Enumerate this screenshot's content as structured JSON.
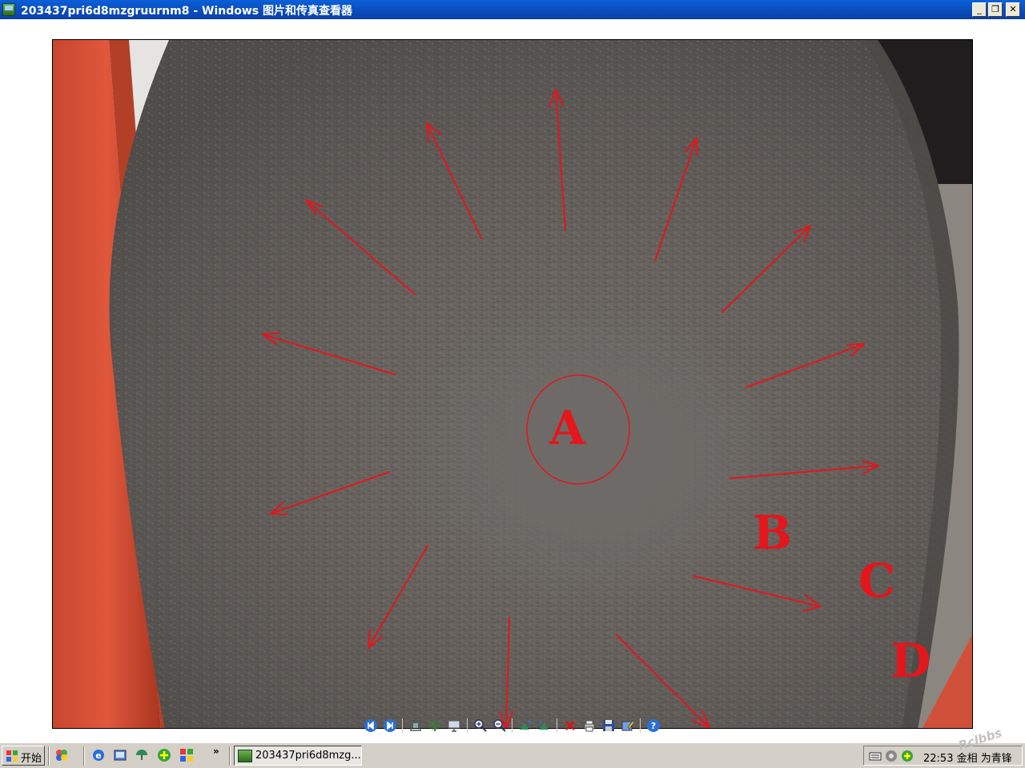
{
  "window": {
    "title": "203437pri6d8mzgruurnm8 - Windows 图片和传真查看器",
    "min": "_",
    "max": "❐",
    "close": "✕"
  },
  "photo": {
    "labels": {
      "a": "A",
      "b": "B",
      "c": "C",
      "d": "D"
    }
  },
  "toolbar": {
    "icons": [
      "prev-image-icon",
      "next-image-icon",
      "best-fit-icon",
      "actual-size-icon",
      "slideshow-icon",
      "zoom-in-icon",
      "zoom-out-icon",
      "rotate-clockwise-icon",
      "rotate-counterclockwise-icon",
      "delete-icon",
      "print-icon",
      "save-icon",
      "edit-icon",
      "help-icon"
    ]
  },
  "taskbar": {
    "start_label": "开始",
    "overflow": "»",
    "task_label": "203437pri6d8mzg...",
    "clock": "22:53 金相 为青锋"
  },
  "watermark": "Rclbbs"
}
